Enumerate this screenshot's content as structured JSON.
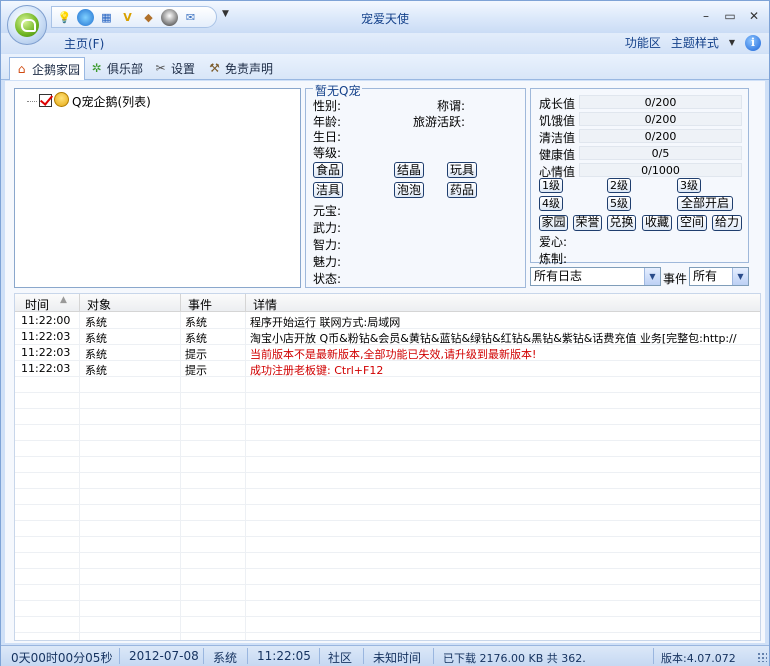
{
  "window": {
    "title": "宠爱天使",
    "buttons": {
      "minimize": "–",
      "maximize": "▭",
      "close": "✕"
    },
    "quick_more": "▼"
  },
  "menu": {
    "home": "主页(F)",
    "function_area": "功能区",
    "theme": "主题样式",
    "theme_arrow": "▼",
    "info": "i"
  },
  "tabs": [
    {
      "label": "企鹅家园",
      "icon": "house-icon",
      "active": true
    },
    {
      "label": "俱乐部",
      "icon": "palm-icon",
      "active": false
    },
    {
      "label": "设置",
      "icon": "tools-icon",
      "active": false
    },
    {
      "label": "免责声明",
      "icon": "gavel-icon",
      "active": false
    }
  ],
  "tree": {
    "root_label": "Q宠企鹅(列表)",
    "checked": true
  },
  "pet": {
    "title": "暂无Q宠",
    "labels": {
      "gender": "性别:",
      "title": "称谓:",
      "age": "年龄:",
      "travel": "旅游活跃:",
      "birthday": "生日:",
      "level": "等级:",
      "yuanbao": "元宝:",
      "force": "武力:",
      "intellect": "智力:",
      "charm": "魅力:",
      "status": "状态:"
    },
    "buttons": [
      "食品",
      "结晶",
      "玩具",
      "洁具",
      "泡泡",
      "药品"
    ]
  },
  "stats": {
    "rows": [
      {
        "label": "成长值",
        "value": "0/200"
      },
      {
        "label": "饥饿值",
        "value": "0/200"
      },
      {
        "label": "清洁值",
        "value": "0/200"
      },
      {
        "label": "健康值",
        "value": "0/5"
      },
      {
        "label": "心情值",
        "value": "0/1000"
      }
    ],
    "level_buttons": [
      "1级",
      "2级",
      "3级",
      "4级",
      "5级",
      "全部开启"
    ],
    "action_buttons": [
      "家园",
      "荣誉",
      "兑换",
      "收藏",
      "空间",
      "给力"
    ],
    "love_label": "爱心:",
    "refine_label": "炼制:"
  },
  "filters": {
    "log_filter": "所有日志",
    "event_label": "事件",
    "event_filter": "所有"
  },
  "log": {
    "columns": [
      "时间",
      "对象",
      "事件",
      "详情"
    ],
    "rows": [
      {
        "time": "11:22:00",
        "object": "系统",
        "event": "系统",
        "detail": "程序开始运行 联网方式:局域网",
        "highlight": false
      },
      {
        "time": "11:22:03",
        "object": "系统",
        "event": "系统",
        "detail": "淘宝小店开放 Q币&粉钻&会员&黄钻&蓝钻&绿钻&红钻&黑钻&紫钻&话费充值 业务[完整包:http://",
        "highlight": false
      },
      {
        "time": "11:22:03",
        "object": "系统",
        "event": "提示",
        "detail": "当前版本不是最新版本,全部功能已失效,请升级到最新版本!",
        "highlight": true
      },
      {
        "time": "11:22:03",
        "object": "系统",
        "event": "提示",
        "detail": "成功注册老板键: Ctrl+F12",
        "highlight": true
      }
    ]
  },
  "status": {
    "uptime": "0天00时00分05秒",
    "date": "2012-07-08",
    "system": "系统",
    "time": "11:22:05",
    "community": "社区",
    "unknown_time": "未知时间",
    "download": "已下载 2176.00 KB 共 362.",
    "version": "版本:4.07.072"
  },
  "colors": {
    "accent": "#15428b",
    "alert": "#d00000",
    "frame": "#cfe0f7"
  }
}
